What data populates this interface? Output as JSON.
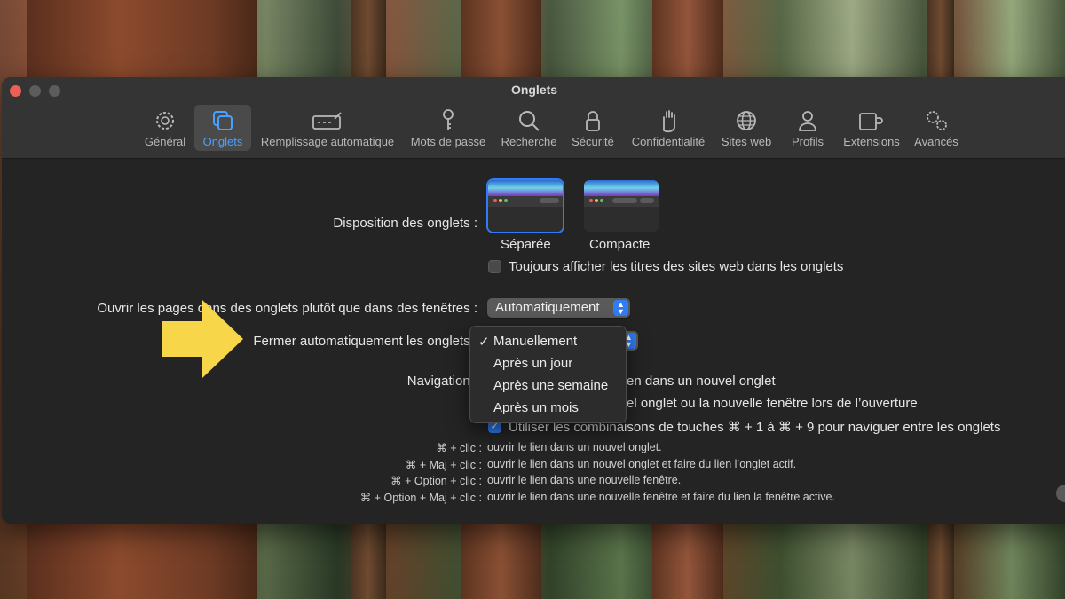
{
  "window": {
    "title": "Onglets"
  },
  "toolbar": {
    "tabs": [
      {
        "label": "Général",
        "icon": "gear-icon"
      },
      {
        "label": "Onglets",
        "icon": "tabs-icon",
        "active": true
      },
      {
        "label": "Remplissage automatique",
        "icon": "autofill-icon"
      },
      {
        "label": "Mots de passe",
        "icon": "key-icon"
      },
      {
        "label": "Recherche",
        "icon": "magnifier-icon"
      },
      {
        "label": "Sécurité",
        "icon": "lock-icon"
      },
      {
        "label": "Confidentialité",
        "icon": "hand-icon"
      },
      {
        "label": "Sites web",
        "icon": "globe-icon"
      },
      {
        "label": "Profils",
        "icon": "person-icon"
      },
      {
        "label": "Extensions",
        "icon": "puzzle-icon"
      },
      {
        "label": "Avancés",
        "icon": "gears-icon"
      }
    ]
  },
  "layout": {
    "label": "Disposition des onglets :",
    "options": [
      {
        "label": "Séparée",
        "selected": true
      },
      {
        "label": "Compacte",
        "selected": false
      }
    ],
    "always_show_titles": {
      "label": "Toujours afficher les titres des sites web dans les onglets",
      "checked": false
    }
  },
  "open_pages": {
    "label": "Ouvrir les pages dans des onglets plutôt que dans des fenêtres :",
    "value": "Automatiquement"
  },
  "close_tabs": {
    "label": "Fermer automatiquement les onglets :",
    "menu": {
      "items": [
        "Manuellement",
        "Après un jour",
        "Après une semaine",
        "Après un mois"
      ],
      "selected": "Manuellement",
      "check_glyph": "✓"
    }
  },
  "navigation": {
    "label": "Navigation :",
    "option1_visible": "en dans un nouvel onglet",
    "option2_visible": "el onglet ou la nouvelle fenêtre lors de l’ouverture",
    "option3": {
      "label": "Utiliser les combinaisons de touches ⌘ + 1 à ⌘ + 9 pour naviguer entre les onglets",
      "checked": true
    }
  },
  "shortcuts": [
    {
      "keys": "⌘ + clic :",
      "desc": "ouvrir le lien dans un nouvel onglet."
    },
    {
      "keys": "⌘ + Maj + clic :",
      "desc": "ouvrir le lien dans un nouvel onglet et faire du lien l’onglet actif."
    },
    {
      "keys": "⌘ + Option + clic :",
      "desc": "ouvrir le lien dans une nouvelle fenêtre."
    },
    {
      "keys": "⌘ + Option + Maj + clic :",
      "desc": "ouvrir le lien dans une nouvelle fenêtre et faire du lien la fenêtre active."
    }
  ],
  "colors": {
    "accent": "#2f7cf6",
    "arrow": "#f7d64a",
    "window_bg": "#242424",
    "toolbar_bg": "#343434"
  }
}
